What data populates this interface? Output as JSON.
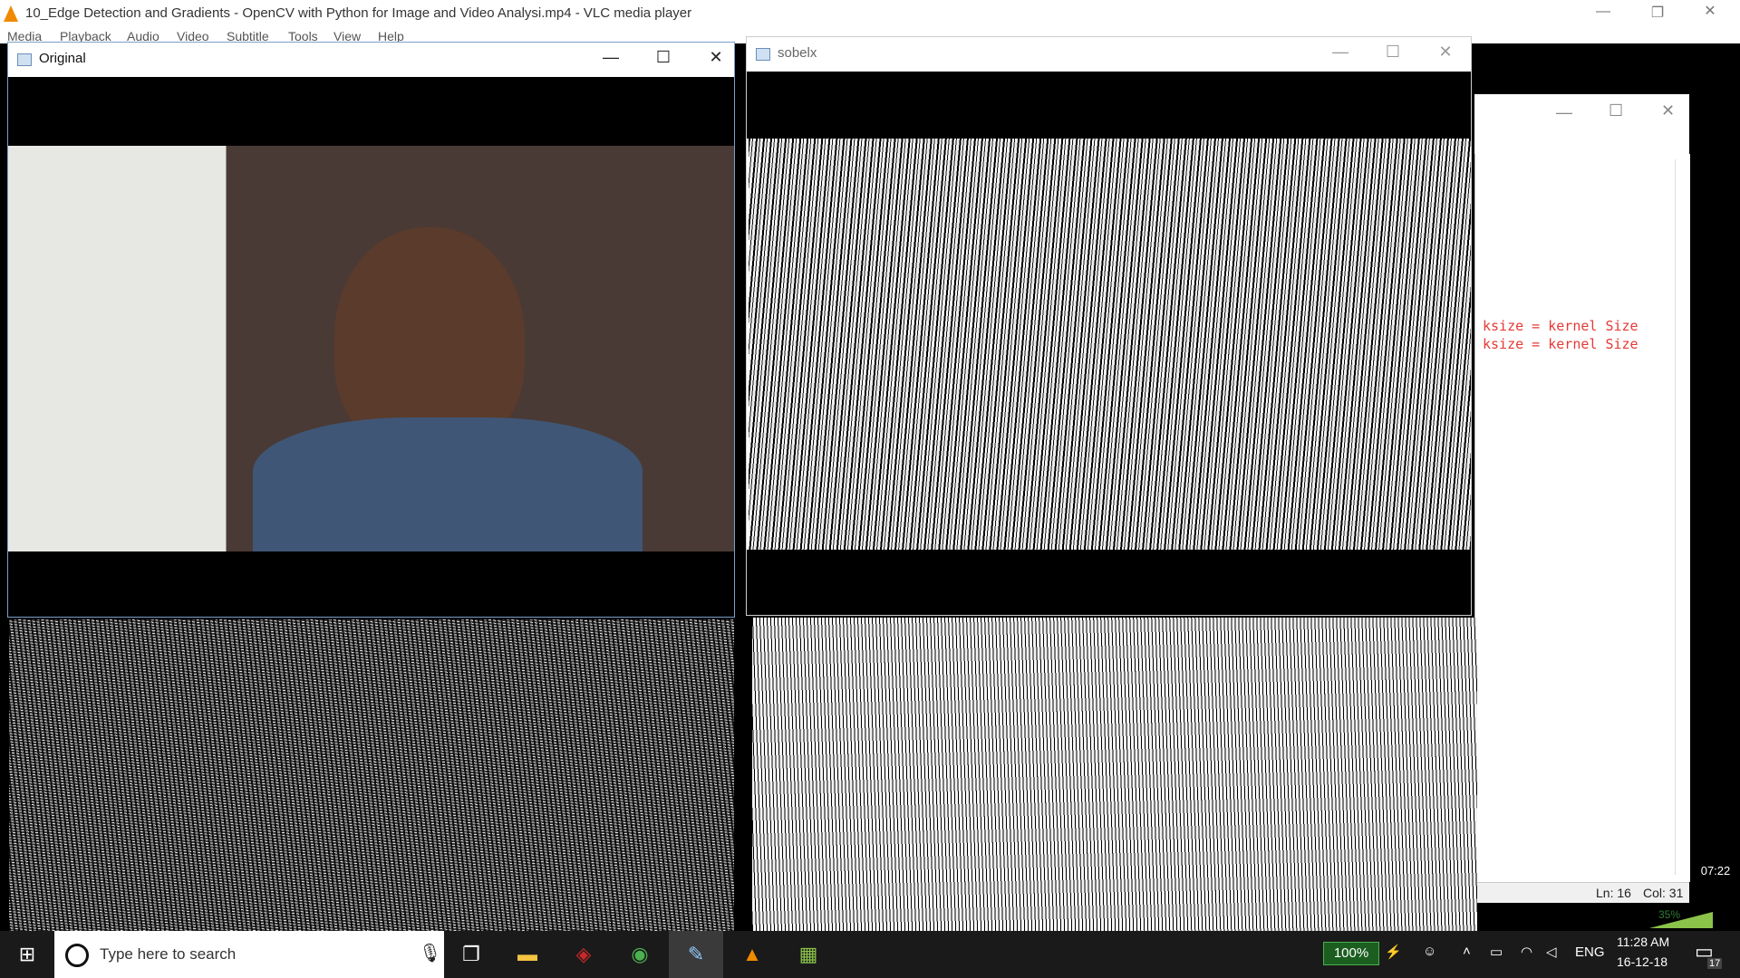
{
  "vlc": {
    "title": "10_Edge Detection and Gradients - OpenCV with Python for Image and Video Analysi.mp4 - VLC media player",
    "menu": [
      "Media",
      "Playback",
      "Audio",
      "Video",
      "Subtitle",
      "Tools",
      "View",
      "Help"
    ],
    "time": "07:22",
    "volume": "35%"
  },
  "windows": {
    "original": {
      "title": "Original"
    },
    "sobelx": {
      "title": "sobelx"
    }
  },
  "editor": {
    "lines": [
      "ksize = kernel Size",
      "ksize = kernel Size"
    ],
    "status": {
      "line": "Ln: 16",
      "col": "Col: 31"
    }
  },
  "taskbar": {
    "search_placeholder": "Type here to search",
    "battery": "100%",
    "lang": "ENG",
    "time": "11:28 AM",
    "date": "16-12-18",
    "notifications": "17"
  },
  "colors": {
    "accent": "#1e90ff",
    "code": "#e53935",
    "vlc_cone": "#f08a00"
  }
}
